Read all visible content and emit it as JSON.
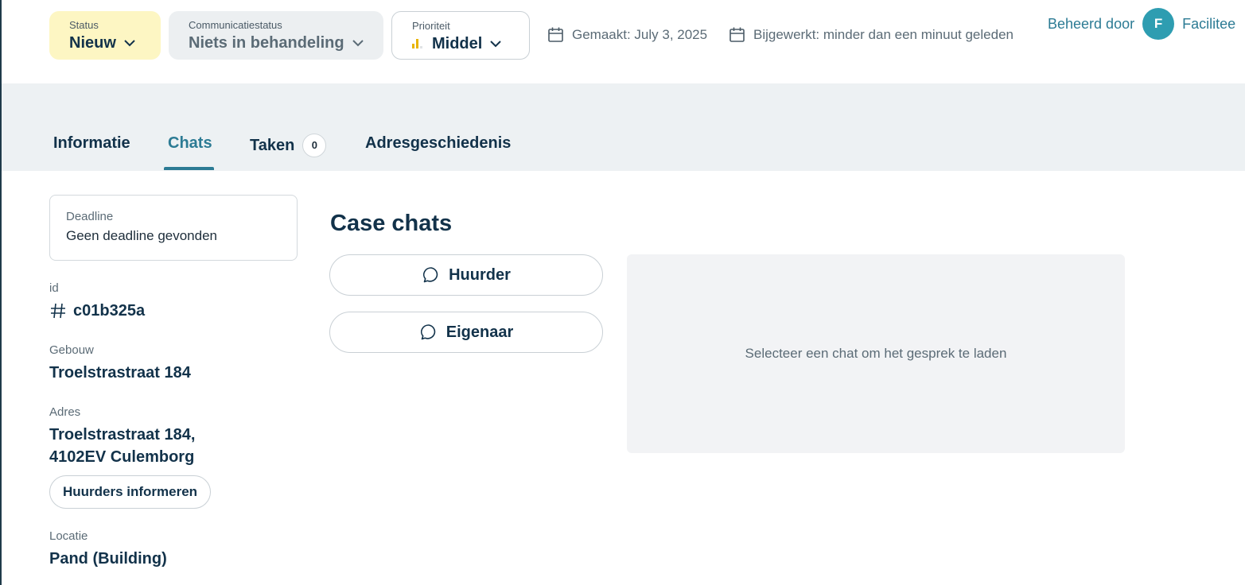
{
  "header": {
    "status": {
      "caption": "Status",
      "value": "Nieuw"
    },
    "communication_status": {
      "caption": "Communicatiestatus",
      "value": "Niets in behandeling"
    },
    "priority": {
      "caption": "Prioriteit",
      "value": "Middel",
      "level": "2 of 3"
    },
    "created": "Gemaakt: July 3, 2025",
    "updated": "Bijgewerkt: minder dan een minuut geleden",
    "managed_by_label": "Beheerd door",
    "managed_by_initial": "F",
    "managed_by_name": "Facilitee"
  },
  "tabs": [
    {
      "label": "Informatie"
    },
    {
      "label": "Chats",
      "active": true
    },
    {
      "label": "Taken",
      "count": "0"
    },
    {
      "label": "Adresgeschiedenis"
    }
  ],
  "details": {
    "deadline_label": "Deadline",
    "deadline_value": "Geen deadline gevonden",
    "id_label": "id",
    "id_value": "c01b325a",
    "building_label": "Gebouw",
    "building_value": "Troelstrastraat 184",
    "address_label": "Adres",
    "address_line1": "Troelstrastraat 184,",
    "address_line2": "4102EV Culemborg",
    "inform_button": "Huurders informeren",
    "location_label": "Locatie",
    "location_value": "Pand (Building)"
  },
  "chats": {
    "title": "Case chats",
    "tenant_button": "Huurder",
    "owner_button": "Eigenaar",
    "empty_message": "Selecteer een chat om het gesprek te laden"
  },
  "colors": {
    "accent": "#2c7b94",
    "status_bg": "#fdf6c3",
    "priority_bar": "#e8b400",
    "avatar": "#2e9db1"
  }
}
